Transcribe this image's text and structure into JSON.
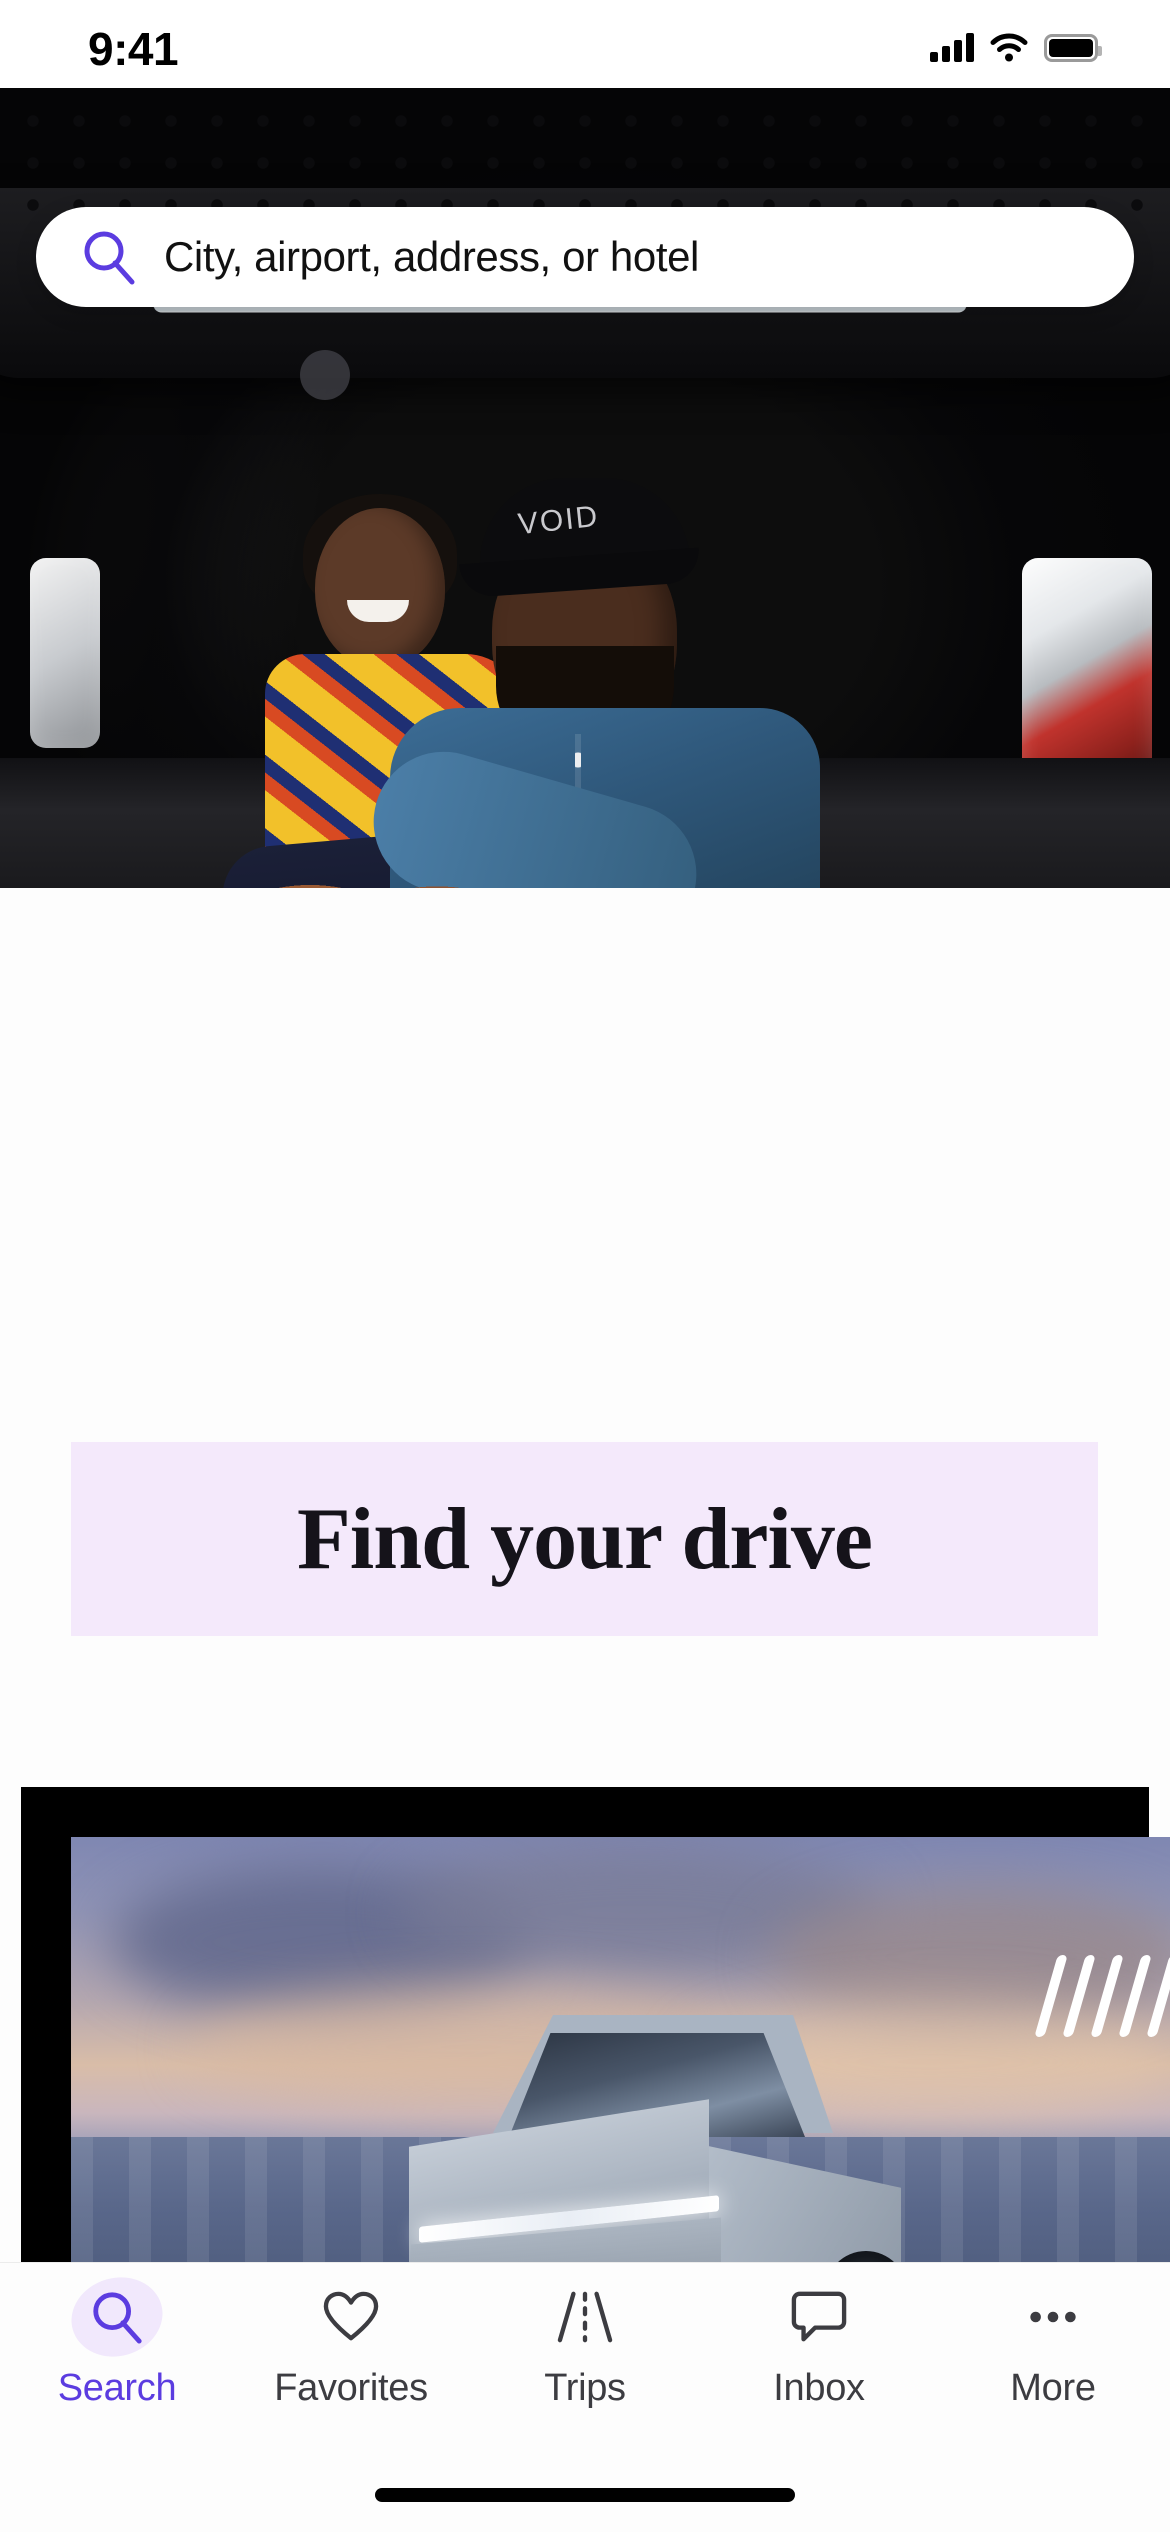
{
  "status_bar": {
    "time": "9:41",
    "icons": [
      "cellular-signal-icon",
      "wifi-icon",
      "battery-icon"
    ]
  },
  "search": {
    "placeholder": "City, airport, address, or hotel",
    "value": "",
    "icon": "search-icon",
    "icon_color": "#5b3ce0"
  },
  "hero": {
    "alt": "Couple sitting in the open trunk of an SUV",
    "overlay_pattern": "polka-dots"
  },
  "band": {
    "heading": "Find your drive",
    "background_color": "#f4e9fb",
    "text_color": "#15131a"
  },
  "promo_card": {
    "alt": "Silver Tesla Cybertruck parked on a beach at sunset",
    "frame_color": "#000000",
    "accent_marks": "diagonal-slashes"
  },
  "tab_bar": {
    "active_index": 0,
    "active_color": "#5b3ce0",
    "inactive_color": "#3c3c41",
    "items": [
      {
        "label": "Search",
        "icon": "search-icon"
      },
      {
        "label": "Favorites",
        "icon": "heart-icon"
      },
      {
        "label": "Trips",
        "icon": "road-icon"
      },
      {
        "label": "Inbox",
        "icon": "speech-bubble-icon"
      },
      {
        "label": "More",
        "icon": "ellipsis-icon"
      }
    ]
  }
}
